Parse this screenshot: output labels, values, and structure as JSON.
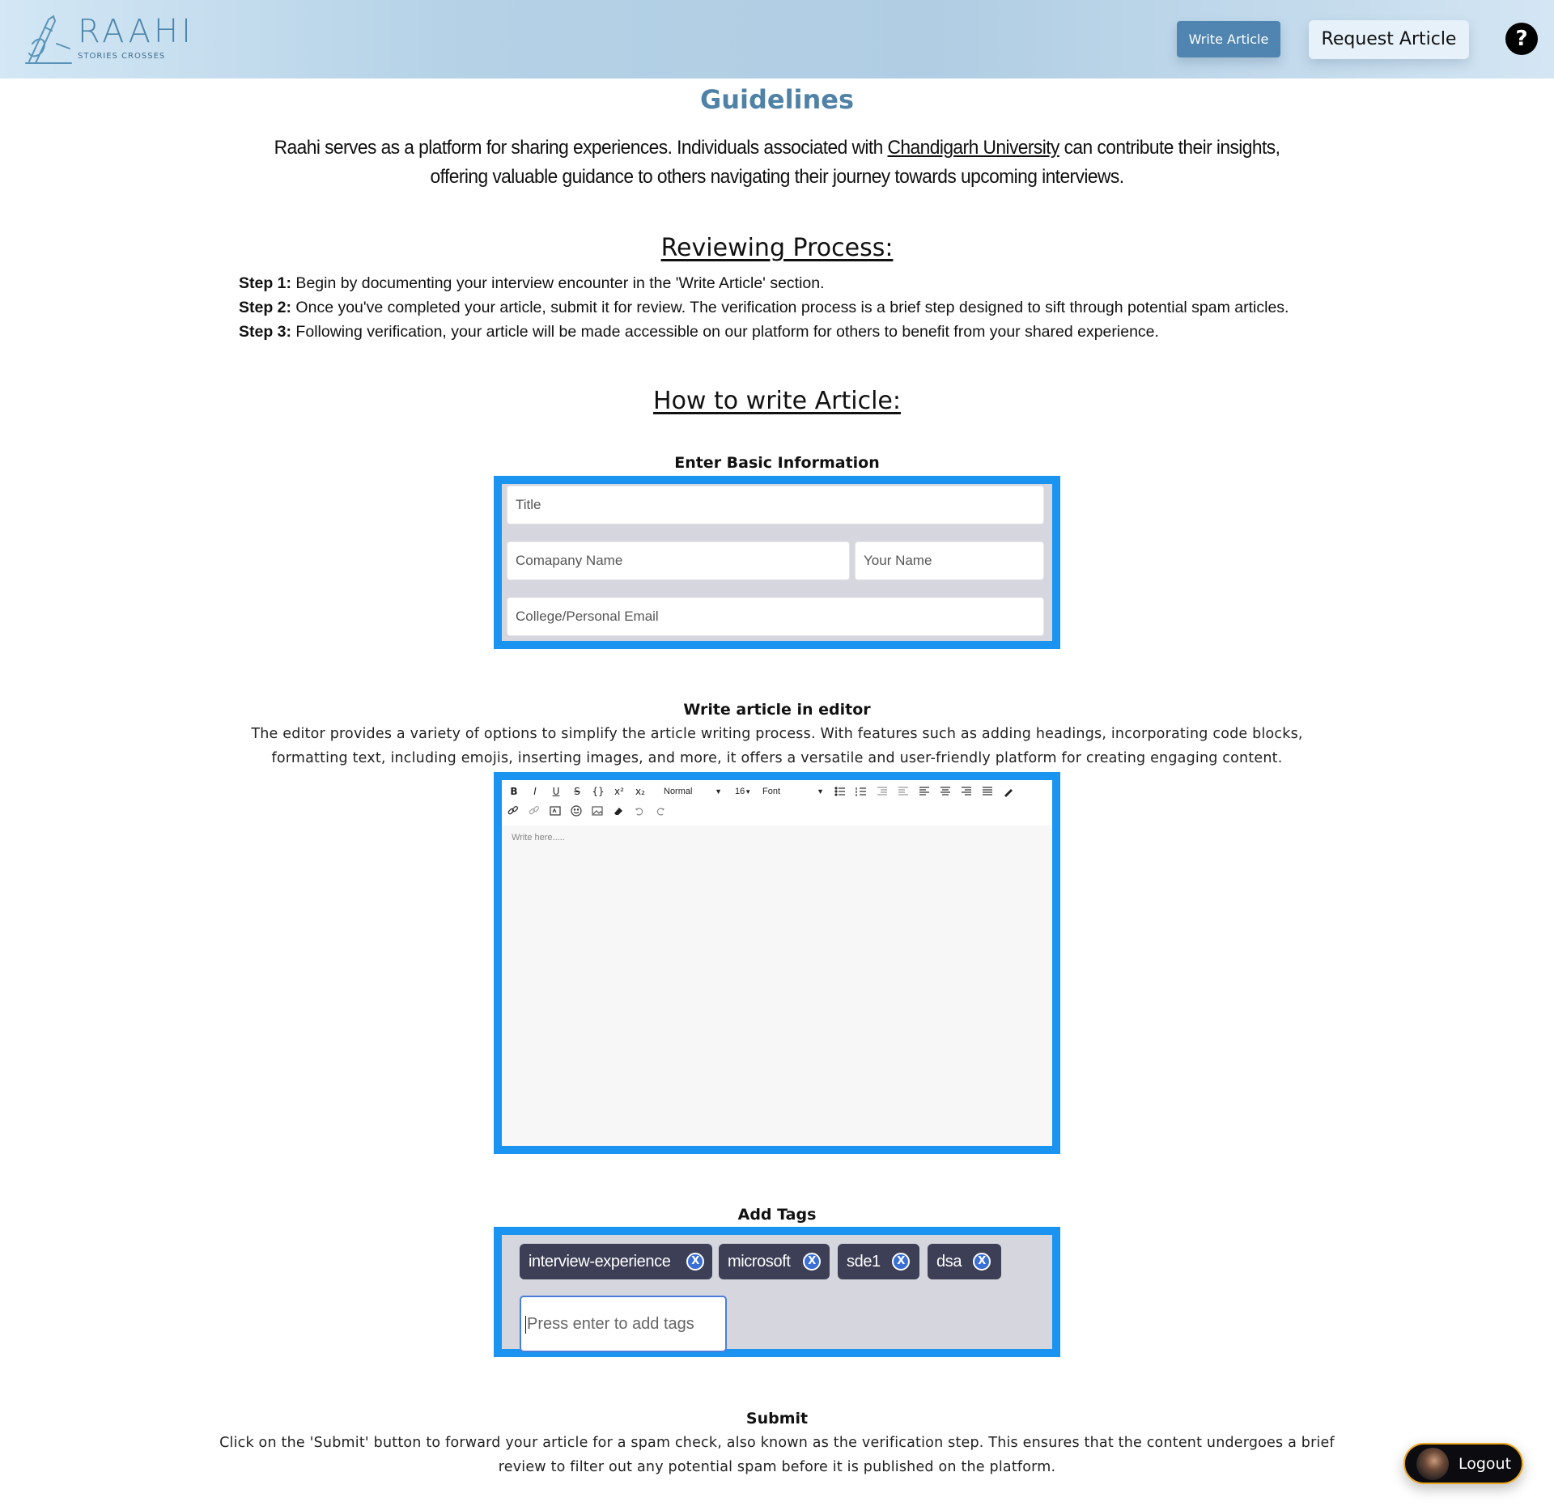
{
  "brand": {
    "name": "RAAHI",
    "tagline": "STORIES CROSSES"
  },
  "nav": {
    "write_label": "Write Article",
    "request_label": "Request Article",
    "help_symbol": "?"
  },
  "page": {
    "title": "Guidelines",
    "intro_before": "Raahi serves as a platform for sharing experiences. Individuals associated with ",
    "intro_link": "Chandigarh University",
    "intro_after": " can contribute their insights, offering valuable guidance to others navigating their journey towards upcoming interviews."
  },
  "review": {
    "heading": "Reviewing Process:",
    "steps": [
      {
        "label": "Step 1:",
        "text": " Begin by documenting your interview encounter in the 'Write Article' section."
      },
      {
        "label": "Step 2:",
        "text": " Once you've completed your article, submit it for review. The verification process is a brief step designed to sift through potential spam articles."
      },
      {
        "label": "Step 3:",
        "text": " Following verification, your article will be made accessible on our platform for others to benefit from your shared experience."
      }
    ]
  },
  "howto": {
    "heading": "How to write Article:",
    "basic": {
      "heading": "Enter Basic Information",
      "title_placeholder": "Title",
      "company_placeholder": "Comapany Name",
      "name_placeholder": "Your Name",
      "email_placeholder": "College/Personal Email"
    },
    "editor": {
      "heading": "Write article in editor",
      "description": "The editor provides a variety of options to simplify the article writing process. With features such as adding headings, incorporating code blocks, formatting text, including emojis, inserting images, and more, it offers a versatile and user-friendly platform for creating engaging content.",
      "toolbar": {
        "bold": "B",
        "italic": "I",
        "underline": "U",
        "strike": "S",
        "code": "{}",
        "superscript": "x²",
        "subscript": "x₂",
        "block_type": "Normal",
        "font_size": "16",
        "font_family": "Font"
      },
      "placeholder": "Write here....."
    },
    "tags": {
      "heading": "Add Tags",
      "items": [
        "interview-experience",
        "microsoft",
        "sde1",
        "dsa"
      ],
      "remove_symbol": "X",
      "input_placeholder": "Press enter to add tags"
    },
    "submit": {
      "heading": "Submit",
      "description": "Click on the 'Submit' button to forward your article for a spam check, also known as the verification step. This ensures that the content undergoes a brief review to filter out any potential spam before it is published on the platform."
    }
  },
  "logout_label": "Logout",
  "colors": {
    "accent": "#1a94f0",
    "title": "#4f82a6",
    "write_button": "#4f85b0",
    "tag_bg": "#3c3f55",
    "logout_border": "#f0a81f"
  }
}
